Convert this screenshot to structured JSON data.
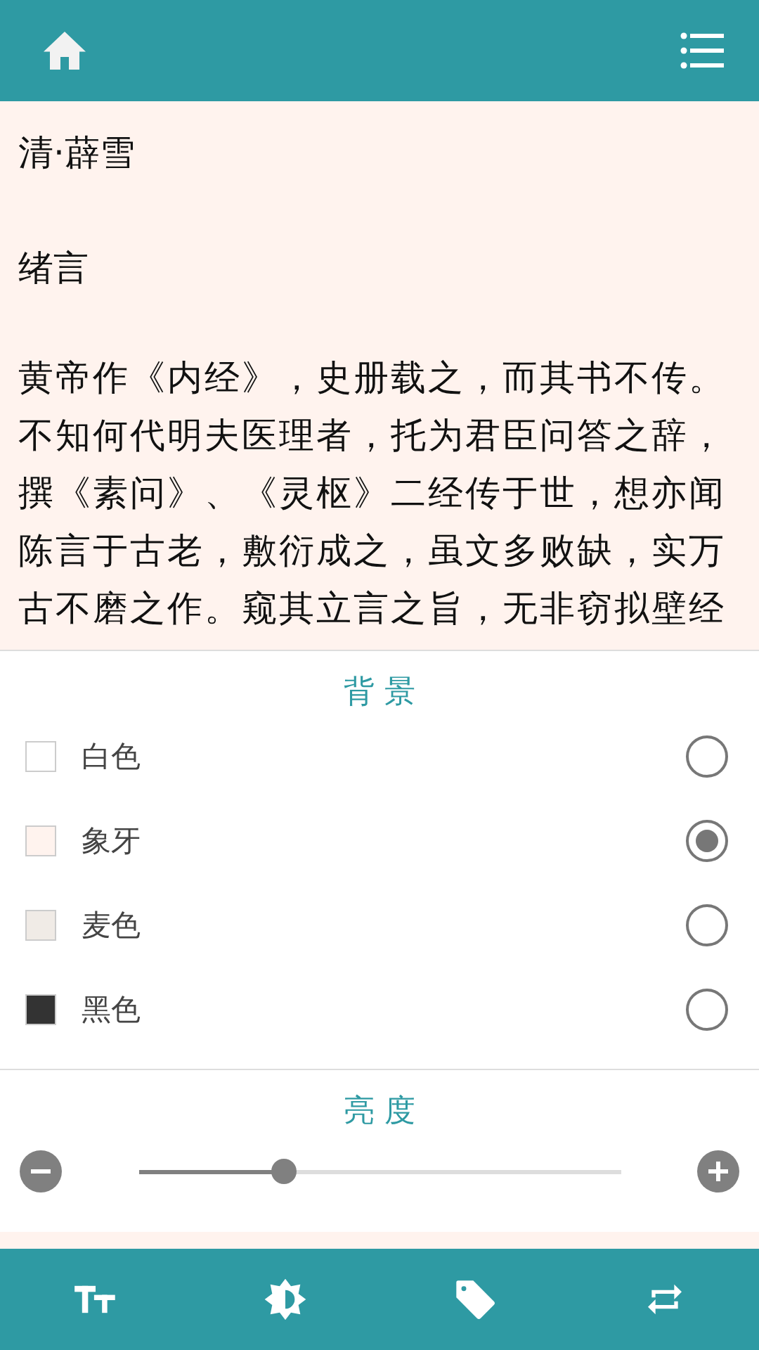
{
  "reader": {
    "author": "清·薜雪",
    "title": "绪言",
    "paragraph": "黄帝作《内经》，史册载之，而其书不传。不知何代明夫医理者，托为君臣问答之辞，撰《素问》、《灵枢》二经传于世，想亦闻陈言于古老，敷衍成之，虽文多败缺，实万古不磨之作。窥其立言之旨，无非窃拟壁经"
  },
  "background": {
    "heading": "背 景",
    "options": [
      {
        "label": "白色",
        "color": "#ffffff",
        "selected": false
      },
      {
        "label": "象牙",
        "color": "#fff3ee",
        "selected": true
      },
      {
        "label": "麦色",
        "color": "#f0ebe6",
        "selected": false
      },
      {
        "label": "黑色",
        "color": "#333333",
        "selected": false
      }
    ]
  },
  "brightness": {
    "heading": "亮 度",
    "level": 0.3
  }
}
